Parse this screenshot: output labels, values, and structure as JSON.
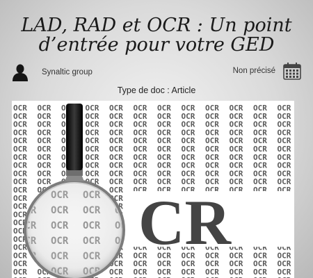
{
  "article": {
    "title_line1": "LAD, RAD et OCR : Un point",
    "title_line2": "d’entrée pour votre GED",
    "author": "Synaltic group",
    "author_icon": "person-icon",
    "date": "Non précisé",
    "date_icon": "calendar-icon",
    "doc_type": "Type de doc : Article"
  },
  "hero_image": {
    "pattern_word": "OCR",
    "large_text": "CR"
  }
}
